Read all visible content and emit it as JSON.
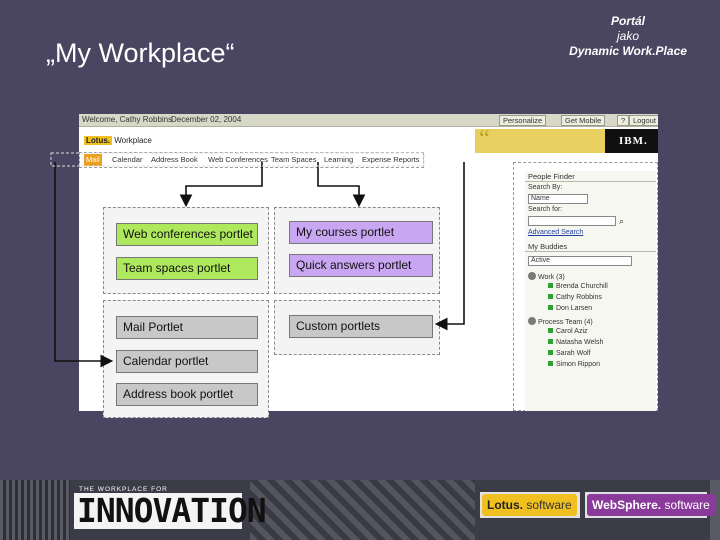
{
  "slide": {
    "title": "„My Workplace“",
    "corner": {
      "line1": "Portál",
      "line2": "jako",
      "line3": "Dynamic Work.Place"
    }
  },
  "portal": {
    "welcome": "Welcome, Cathy Robbins",
    "date": "December 02, 2004",
    "toolbar": [
      "Personalize",
      "Get Mobile",
      "?",
      "Logout"
    ],
    "logo": {
      "mark": "Lotus.",
      "text": "Workplace"
    },
    "ibm": "IBM.",
    "tabs": [
      "Mail",
      "Calendar",
      "Address Book",
      "Web Conferences",
      "Team Spaces",
      "Learning",
      "Expense Reports"
    ],
    "people_finder": {
      "title": "People Finder",
      "search_by_label": "Search By:",
      "search_by_value": "Name",
      "search_for_label": "Search for:",
      "advanced": "Advanced Search"
    },
    "my_buddies": {
      "title": "My Buddies",
      "status": "Active",
      "groups": [
        {
          "name": "Work (3)",
          "members": [
            "Brenda Churchill",
            "Cathy Robbins",
            "Don Larsen"
          ]
        },
        {
          "name": "Process Team (4)",
          "members": [
            "Carol Aziz",
            "Natasha Welsh",
            "Sarah Wolf",
            "Simon Rippon"
          ]
        }
      ]
    }
  },
  "portlets": {
    "web_conferences": "Web conferences portlet",
    "team_spaces": "Team spaces portlet",
    "my_courses": "My courses portlet",
    "quick_answers": "Quick answers portlet",
    "mail": "Mail Portlet",
    "calendar": "Calendar portlet",
    "address_book": "Address book portlet",
    "custom": "Custom portlets"
  },
  "colors": {
    "background": "#4a4560",
    "green_label": "#aee85c",
    "violet_label": "#c9a6f2",
    "gray_label": "#c8c8c8"
  },
  "footer": {
    "tagline": "THE WORKPLACE FOR",
    "innovation": "INNOVATION",
    "lotus": {
      "brand": "Lotus.",
      "suffix": "software"
    },
    "websphere": {
      "brand": "WebSphere.",
      "suffix": "software"
    }
  }
}
